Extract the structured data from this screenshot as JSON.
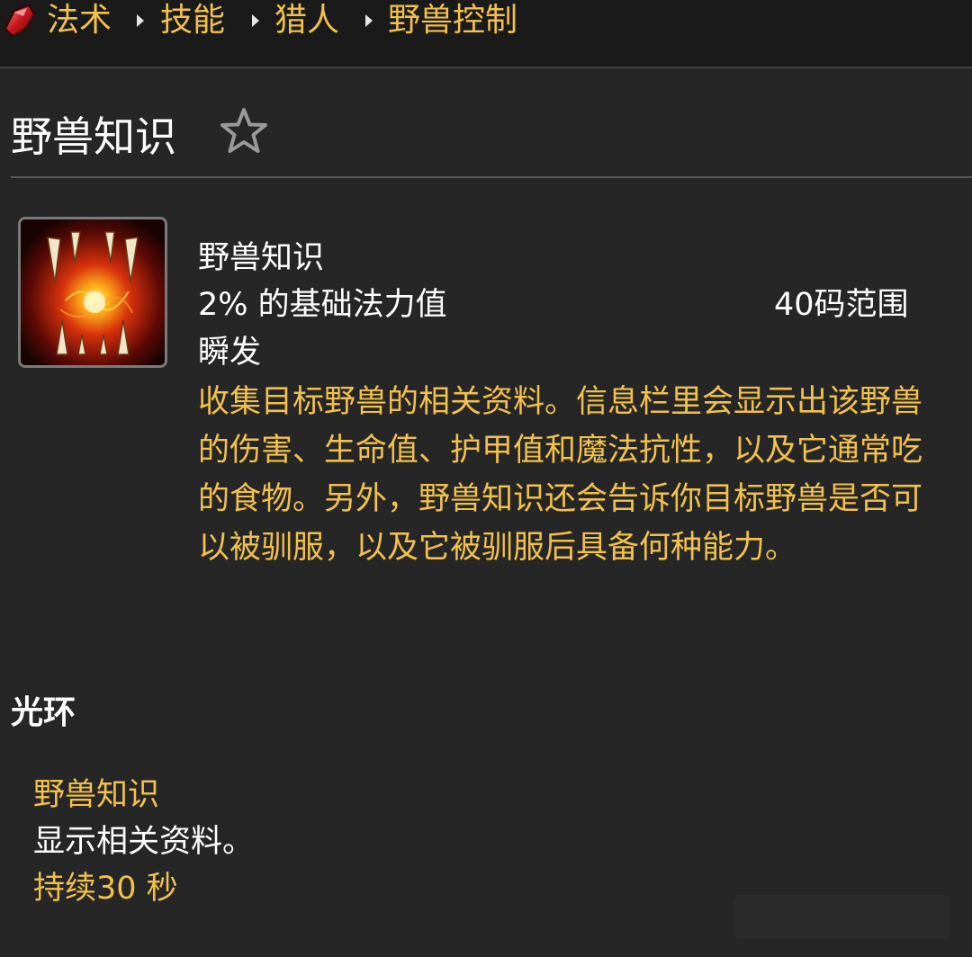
{
  "breadcrumb": {
    "items": [
      "法术",
      "技能",
      "猎人",
      "野兽控制"
    ]
  },
  "page": {
    "title": "野兽知识",
    "favorite_icon": "star-outline-icon"
  },
  "spell": {
    "icon": "beast-lore-fangs-icon",
    "name": "野兽知识",
    "cost": "2% 的基础法力值",
    "range": "40码范围",
    "cast": "瞬发",
    "description": "收集目标野兽的相关资料。信息栏里会显示出该野兽的伤害、生命值、护甲值和魔法抗性，以及它通常吃的食物。另外，野兽知识还会告诉你目标野兽是否可以被驯服，以及它被驯服后具备何种能力。"
  },
  "aura_section": {
    "heading": "光环",
    "name": "野兽知识",
    "effect": "显示相关资料。",
    "duration": "持续30 秒"
  },
  "colors": {
    "background": "#262626",
    "topbar": "#1a1a1a",
    "accent_gold": "#f2c14b",
    "text": "#ffffff"
  }
}
